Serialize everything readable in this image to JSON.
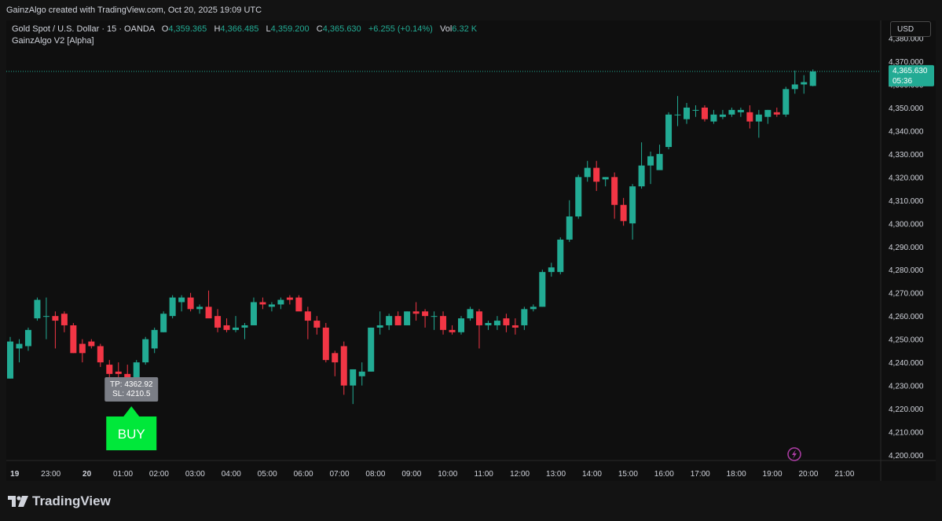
{
  "header": {
    "created_text": "GainzAlgo created with TradingView.com, Oct 20, 2025 19:09 UTC"
  },
  "legend": {
    "symbol": "Gold Spot / U.S. Dollar · 15 · OANDA",
    "o_label": "O",
    "o_value": "4,359.365",
    "h_label": "H",
    "h_value": "4,366.485",
    "l_label": "L",
    "l_value": "4,359.200",
    "c_label": "C",
    "c_value": "4,365.630",
    "change": "+6.255 (+0.14%)",
    "vol_label": "Vol",
    "vol_value": "6.32 K",
    "indicator": "GainzAlgo V2 [Alpha]"
  },
  "currency_button": "USD",
  "brand": {
    "logo_text": "TradingView",
    "logo_icon": "tradingview-logo-icon"
  },
  "colors": {
    "up": "#22ab94",
    "down": "#f23645",
    "buy": "#00e83a",
    "label_bg": "#7b7e86",
    "background": "#0f0f0f"
  },
  "chart_data": {
    "type": "candlestick",
    "symbol": "Gold Spot / U.S. Dollar",
    "interval": "15",
    "y_axis": {
      "ticks": [
        4200,
        4210,
        4220,
        4230,
        4240,
        4250,
        4260,
        4270,
        4280,
        4290,
        4300,
        4310,
        4320,
        4330,
        4340,
        4350,
        4360,
        4370,
        4380
      ],
      "tick_labels": [
        "4,200.000",
        "4,210.000",
        "4,220.000",
        "4,230.000",
        "4,240.000",
        "4,250.000",
        "4,260.000",
        "4,270.000",
        "4,280.000",
        "4,290.000",
        "4,300.000",
        "4,310.000",
        "4,320.000",
        "4,330.000",
        "4,340.000",
        "4,350.000",
        "4,360.000",
        "4,370.000",
        "4,380.000"
      ],
      "range": [
        4196,
        4382
      ]
    },
    "x_axis": {
      "tick_labels": [
        "19",
        "23:00",
        "20",
        "01:00",
        "02:00",
        "03:00",
        "04:00",
        "05:00",
        "06:00",
        "07:00",
        "08:00",
        "09:00",
        "10:00",
        "11:00",
        "12:00",
        "13:00",
        "14:00",
        "15:00",
        "16:00",
        "17:00",
        "18:00",
        "19:00",
        "20:00",
        "21:00"
      ],
      "tick_index": [
        0.5,
        4.5,
        8.5,
        12.5,
        16.5,
        20.5,
        24.5,
        28.5,
        32.5,
        36.5,
        40.5,
        44.5,
        48.5,
        52.5,
        56.5,
        60.5,
        64.5,
        68.5,
        72.5,
        76.5,
        80.5,
        84.5,
        88.5,
        92.5
      ]
    },
    "last_price": {
      "label": "4,365.630",
      "countdown": "05:36",
      "value": 4365.63
    },
    "candles": [
      {
        "o": 4233,
        "h": 4251,
        "l": 4233,
        "c": 4249
      },
      {
        "o": 4246,
        "h": 4250,
        "l": 4240,
        "c": 4248
      },
      {
        "o": 4247,
        "h": 4255,
        "l": 4245,
        "c": 4254
      },
      {
        "o": 4259,
        "h": 4268,
        "l": 4258,
        "c": 4267
      },
      {
        "o": 4260,
        "h": 4268,
        "l": 4250,
        "c": 4260
      },
      {
        "o": 4260,
        "h": 4262,
        "l": 4246,
        "c": 4258
      },
      {
        "o": 4261,
        "h": 4262,
        "l": 4253,
        "c": 4256
      },
      {
        "o": 4256,
        "h": 4257,
        "l": 4244,
        "c": 4244
      },
      {
        "o": 4248,
        "h": 4250,
        "l": 4240,
        "c": 4244
      },
      {
        "o": 4249,
        "h": 4250,
        "l": 4246,
        "c": 4247
      },
      {
        "o": 4247,
        "h": 4248,
        "l": 4238,
        "c": 4240
      },
      {
        "o": 4239,
        "h": 4241,
        "l": 4231,
        "c": 4235
      },
      {
        "o": 4236,
        "h": 4240,
        "l": 4226,
        "c": 4235
      },
      {
        "o": 4235,
        "h": 4239,
        "l": 4225,
        "c": 4228
      },
      {
        "o": 4230,
        "h": 4241,
        "l": 4227,
        "c": 4240
      },
      {
        "o": 4240,
        "h": 4251,
        "l": 4239,
        "c": 4250
      },
      {
        "o": 4246,
        "h": 4255,
        "l": 4244,
        "c": 4254
      },
      {
        "o": 4253,
        "h": 4262,
        "l": 4253,
        "c": 4261
      },
      {
        "o": 4260,
        "h": 4269,
        "l": 4259,
        "c": 4268
      },
      {
        "o": 4266,
        "h": 4269,
        "l": 4262,
        "c": 4268
      },
      {
        "o": 4268,
        "h": 4270,
        "l": 4262,
        "c": 4263
      },
      {
        "o": 4263,
        "h": 4265,
        "l": 4261,
        "c": 4264
      },
      {
        "o": 4264,
        "h": 4271,
        "l": 4261,
        "c": 4259
      },
      {
        "o": 4260,
        "h": 4263,
        "l": 4253,
        "c": 4255
      },
      {
        "o": 4256,
        "h": 4259,
        "l": 4253,
        "c": 4254
      },
      {
        "o": 4254,
        "h": 4260,
        "l": 4253,
        "c": 4255
      },
      {
        "o": 4255,
        "h": 4257,
        "l": 4250,
        "c": 4256
      },
      {
        "o": 4256,
        "h": 4268,
        "l": 4256,
        "c": 4266
      },
      {
        "o": 4266,
        "h": 4268,
        "l": 4263,
        "c": 4265
      },
      {
        "o": 4264,
        "h": 4266,
        "l": 4262,
        "c": 4265
      },
      {
        "o": 4265,
        "h": 4268,
        "l": 4263,
        "c": 4267
      },
      {
        "o": 4268,
        "h": 4269,
        "l": 4265,
        "c": 4267
      },
      {
        "o": 4268,
        "h": 4269,
        "l": 4264,
        "c": 4262
      },
      {
        "o": 4262,
        "h": 4264,
        "l": 4250,
        "c": 4258
      },
      {
        "o": 4258,
        "h": 4260,
        "l": 4252,
        "c": 4255
      },
      {
        "o": 4255,
        "h": 4257,
        "l": 4240,
        "c": 4241
      },
      {
        "o": 4244,
        "h": 4245,
        "l": 4234,
        "c": 4240
      },
      {
        "o": 4247,
        "h": 4249,
        "l": 4226,
        "c": 4230
      },
      {
        "o": 4230,
        "h": 4237,
        "l": 4222,
        "c": 4237
      },
      {
        "o": 4234,
        "h": 4240,
        "l": 4230,
        "c": 4236
      },
      {
        "o": 4236,
        "h": 4255,
        "l": 4236,
        "c": 4255
      },
      {
        "o": 4255,
        "h": 4262,
        "l": 4252,
        "c": 4256
      },
      {
        "o": 4256,
        "h": 4261,
        "l": 4254,
        "c": 4260
      },
      {
        "o": 4260,
        "h": 4262,
        "l": 4256,
        "c": 4256
      },
      {
        "o": 4256,
        "h": 4262,
        "l": 4256,
        "c": 4262
      },
      {
        "o": 4262,
        "h": 4266,
        "l": 4258,
        "c": 4261
      },
      {
        "o": 4262,
        "h": 4263,
        "l": 4255,
        "c": 4260
      },
      {
        "o": 4260,
        "h": 4262,
        "l": 4254,
        "c": 4260
      },
      {
        "o": 4260,
        "h": 4262,
        "l": 4252,
        "c": 4254
      },
      {
        "o": 4254,
        "h": 4256,
        "l": 4252,
        "c": 4253
      },
      {
        "o": 4253,
        "h": 4260,
        "l": 4252,
        "c": 4259
      },
      {
        "o": 4259,
        "h": 4264,
        "l": 4258,
        "c": 4263
      },
      {
        "o": 4262,
        "h": 4263,
        "l": 4246,
        "c": 4256
      },
      {
        "o": 4256,
        "h": 4258,
        "l": 4254,
        "c": 4257
      },
      {
        "o": 4256,
        "h": 4260,
        "l": 4254,
        "c": 4258
      },
      {
        "o": 4259,
        "h": 4261,
        "l": 4253,
        "c": 4256
      },
      {
        "o": 4256,
        "h": 4259,
        "l": 4252,
        "c": 4255
      },
      {
        "o": 4256,
        "h": 4264,
        "l": 4254,
        "c": 4263
      },
      {
        "o": 4263,
        "h": 4265,
        "l": 4262,
        "c": 4264
      },
      {
        "o": 4264,
        "h": 4280,
        "l": 4264,
        "c": 4279
      },
      {
        "o": 4279,
        "h": 4283,
        "l": 4277,
        "c": 4281
      },
      {
        "o": 4279,
        "h": 4294,
        "l": 4278,
        "c": 4293
      },
      {
        "o": 4293,
        "h": 4310,
        "l": 4292,
        "c": 4303
      },
      {
        "o": 4303,
        "h": 4321,
        "l": 4302,
        "c": 4320
      },
      {
        "o": 4320,
        "h": 4327,
        "l": 4318,
        "c": 4324
      },
      {
        "o": 4324,
        "h": 4327,
        "l": 4314,
        "c": 4318
      },
      {
        "o": 4319,
        "h": 4320,
        "l": 4316,
        "c": 4320
      },
      {
        "o": 4320,
        "h": 4322,
        "l": 4302,
        "c": 4308
      },
      {
        "o": 4308,
        "h": 4311,
        "l": 4299,
        "c": 4301
      },
      {
        "o": 4300,
        "h": 4317,
        "l": 4293,
        "c": 4316
      },
      {
        "o": 4316,
        "h": 4335,
        "l": 4315,
        "c": 4325
      },
      {
        "o": 4325,
        "h": 4331,
        "l": 4317,
        "c": 4329
      },
      {
        "o": 4323,
        "h": 4334,
        "l": 4323,
        "c": 4330
      },
      {
        "o": 4333,
        "h": 4348,
        "l": 4332,
        "c": 4347
      },
      {
        "o": 4347,
        "h": 4355,
        "l": 4342,
        "c": 4347
      },
      {
        "o": 4345,
        "h": 4352,
        "l": 4343,
        "c": 4350
      },
      {
        "o": 4349,
        "h": 4351,
        "l": 4346,
        "c": 4349
      },
      {
        "o": 4350,
        "h": 4351,
        "l": 4344,
        "c": 4345
      },
      {
        "o": 4344,
        "h": 4349,
        "l": 4343,
        "c": 4347
      },
      {
        "o": 4346,
        "h": 4349,
        "l": 4345,
        "c": 4347
      },
      {
        "o": 4347,
        "h": 4350,
        "l": 4346,
        "c": 4349
      },
      {
        "o": 4348,
        "h": 4350,
        "l": 4346,
        "c": 4349
      },
      {
        "o": 4348,
        "h": 4351,
        "l": 4341,
        "c": 4344
      },
      {
        "o": 4344,
        "h": 4349,
        "l": 4337,
        "c": 4347
      },
      {
        "o": 4346,
        "h": 4349,
        "l": 4343,
        "c": 4349
      },
      {
        "o": 4348,
        "h": 4350,
        "l": 4346,
        "c": 4347
      },
      {
        "o": 4347,
        "h": 4359,
        "l": 4346,
        "c": 4358
      },
      {
        "o": 4358,
        "h": 4366,
        "l": 4356,
        "c": 4360
      },
      {
        "o": 4360,
        "h": 4364,
        "l": 4356,
        "c": 4361
      },
      {
        "o": 4359.365,
        "h": 4366.485,
        "l": 4359.2,
        "c": 4365.63
      }
    ],
    "signals": [
      {
        "type": "BUY",
        "index": 13,
        "tp_label": "TP: 4362.92",
        "sl_label": "SL: 4210.5"
      }
    ]
  }
}
